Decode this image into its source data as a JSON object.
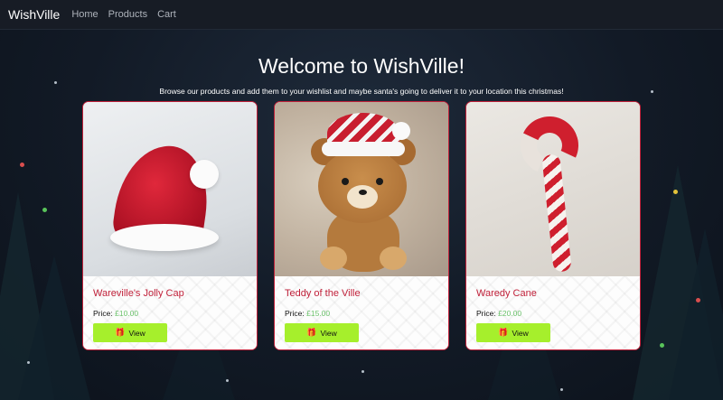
{
  "navbar": {
    "brand": "WishVille",
    "links": [
      "Home",
      "Products",
      "Cart"
    ]
  },
  "hero": {
    "title": "Welcome to WishVille!",
    "subtitle": "Browse our products and add them to your wishlist and maybe santa's going to deliver it to your location this christmas!"
  },
  "products": [
    {
      "title": "Wareville's Jolly Cap",
      "price_label": "Price:",
      "price": "£10.00",
      "button": "View",
      "image": "santa-hat"
    },
    {
      "title": "Teddy of the Ville",
      "price_label": "Price:",
      "price": "£15.00",
      "button": "View",
      "image": "teddy-bear"
    },
    {
      "title": "Waredy Cane",
      "price_label": "Price:",
      "price": "£20.00",
      "button": "View",
      "image": "candy-cane"
    }
  ],
  "colors": {
    "accent_red": "#c0213a",
    "button_green": "#a6ef2c",
    "price_green": "#6cc36c",
    "navbar_bg": "#171c25"
  },
  "icons": {
    "view_button": "gift-icon"
  }
}
